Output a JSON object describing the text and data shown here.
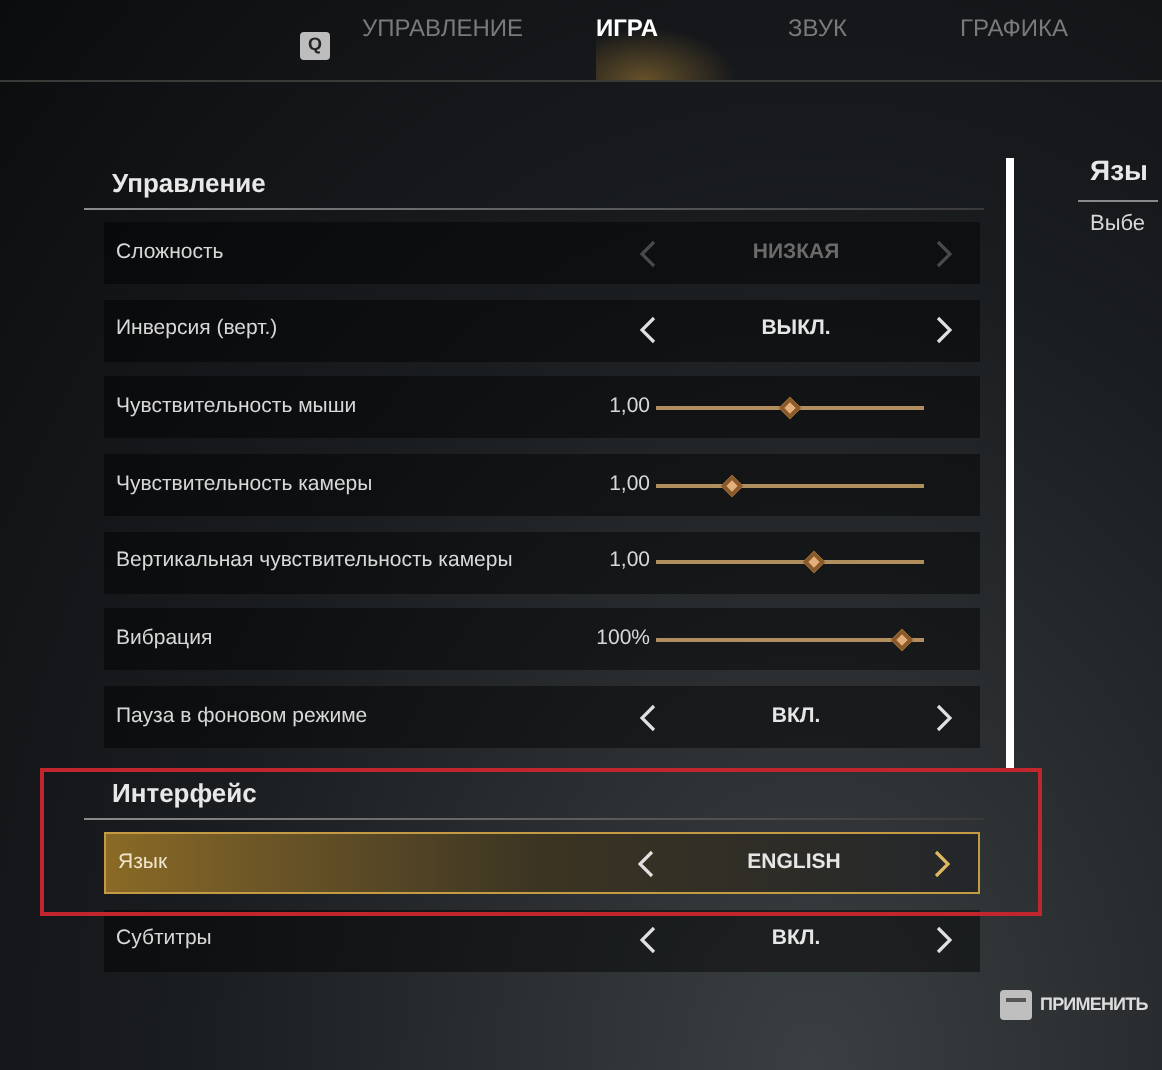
{
  "tabs_bar": {
    "key_hint": "Q",
    "tabs": [
      {
        "label": "УПРАВЛЕНИЕ",
        "selected": false
      },
      {
        "label": "ИГРА",
        "selected": true
      },
      {
        "label": "ЗВУК",
        "selected": false
      },
      {
        "label": "ГРАФИКА",
        "selected": false
      }
    ]
  },
  "sections": [
    {
      "title": "Управление",
      "rows": [
        {
          "kind": "choice",
          "label": "Сложность",
          "value": "НИЗКАЯ",
          "disabled": true,
          "selected": false
        },
        {
          "kind": "choice",
          "label": "Инверсия (верт.)",
          "value": "ВЫКЛ.",
          "disabled": false,
          "selected": false
        },
        {
          "kind": "slider",
          "label": "Чувствительность мыши",
          "reading": "1,00",
          "level": 0.5,
          "selected": false
        },
        {
          "kind": "slider",
          "label": "Чувствительность камеры",
          "reading": "1,00",
          "level": 0.26,
          "selected": false
        },
        {
          "kind": "slider",
          "label": "Вертикальная чувствительность камеры",
          "reading": "1,00",
          "level": 0.6,
          "selected": false
        },
        {
          "kind": "slider",
          "label": "Вибрация",
          "reading": "100%",
          "level": 0.96,
          "selected": false
        },
        {
          "kind": "choice",
          "label": "Пауза в фоновом режиме",
          "value": "ВКЛ.",
          "disabled": false,
          "selected": false
        }
      ]
    },
    {
      "title": "Интерфейс",
      "rows": [
        {
          "kind": "choice",
          "label": "Язык",
          "value": "ENGLISH",
          "disabled": false,
          "selected": true
        },
        {
          "kind": "choice",
          "label": "Субтитры",
          "value": "ВКЛ.",
          "disabled": false,
          "selected": false
        }
      ]
    }
  ],
  "info_panel": {
    "title": "Язы",
    "description": "Выбе"
  },
  "footer": {
    "apply_label": "ПРИМЕНИТЬ"
  }
}
